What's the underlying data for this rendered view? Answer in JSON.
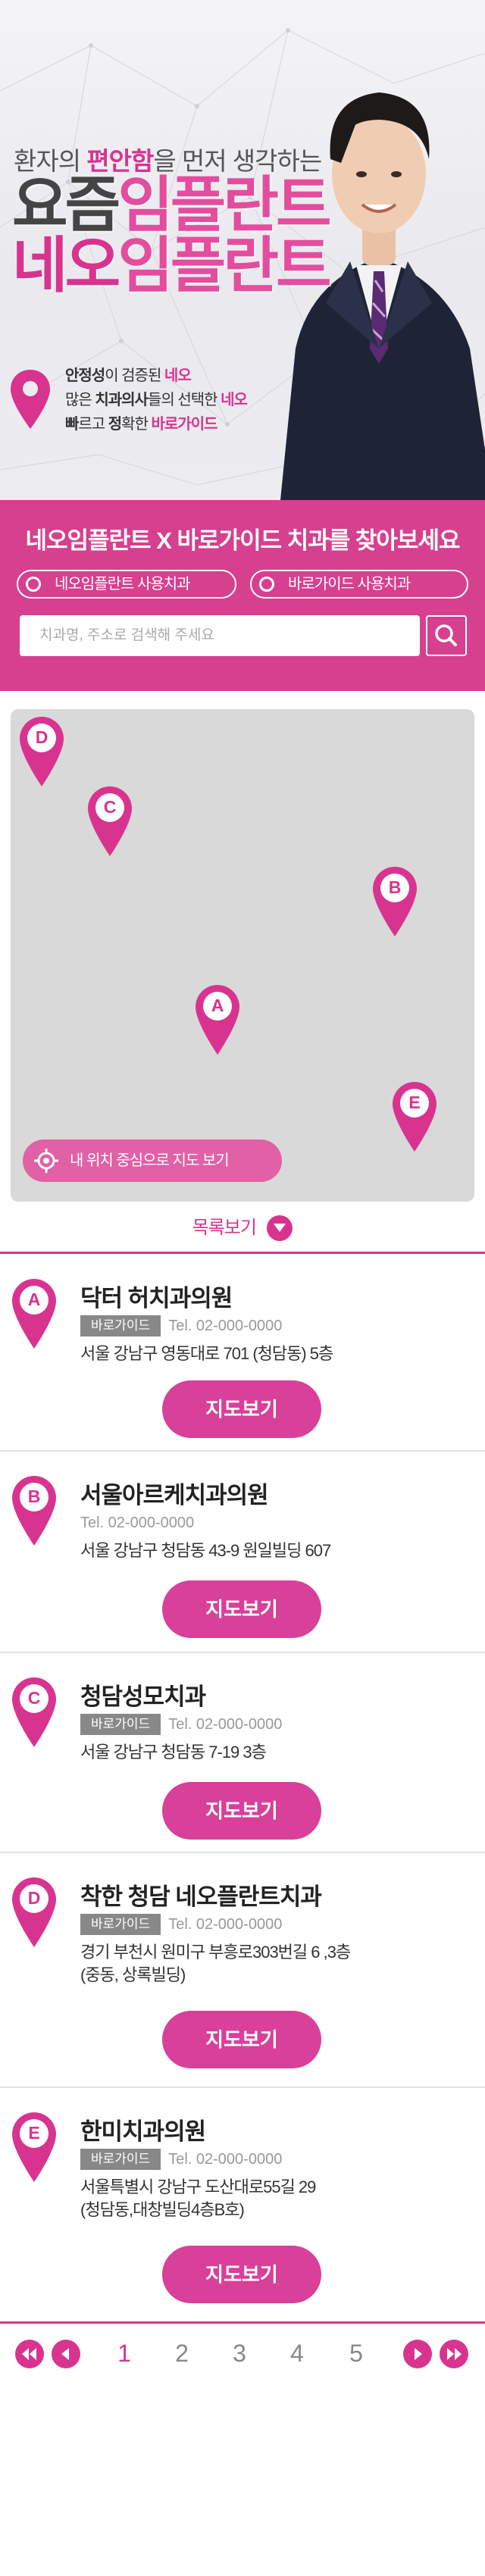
{
  "hero": {
    "tagline_pre": "환자의 ",
    "tagline_em": "편안함",
    "tagline_post": "을 먼저 생각하는",
    "line1_a": "요즘",
    "line1_b": "임플란트",
    "line2_a": "네오",
    "line2_b": "임플란트",
    "points": [
      {
        "b": "안정성",
        "t": "이 검증된 ",
        "p": "네오"
      },
      {
        "b": "",
        "t": "많은 ",
        "b2": "치과의사",
        "t2": "들의 선택한 ",
        "p": "네오"
      },
      {
        "b": "빠",
        "t": "르고 ",
        "b2": "정",
        "t2": "확한 ",
        "p": "바로가이드"
      }
    ]
  },
  "search": {
    "title": "네오임플란트 X 바로가이드 치과를 찾아보세요",
    "radio1": "네오임플란트 사용치과",
    "radio2": "바로가이드 사용치과",
    "placeholder": "치과명, 주소로 검색해 주세요"
  },
  "map": {
    "locate_label": "내 위치 중심으로 지도 보기",
    "pins": [
      "D",
      "C",
      "B",
      "A",
      "E"
    ]
  },
  "list_toggle": "목록보기",
  "clinics": [
    {
      "letter": "A",
      "name": "닥터 허치과의원",
      "badge": "바로가이드",
      "tel": "Tel. 02-000-0000",
      "addr1": "서울 강남구 영동대로 701 (청담동) 5층",
      "addr2": "",
      "button": "지도보기"
    },
    {
      "letter": "B",
      "name": "서울아르케치과의원",
      "badge": "",
      "tel": "Tel. 02-000-0000",
      "addr1": "서울 강남구 청담동 43-9 원일빌딩 607",
      "addr2": "",
      "button": "지도보기"
    },
    {
      "letter": "C",
      "name": "청담성모치과",
      "badge": "바로가이드",
      "tel": "Tel. 02-000-0000",
      "addr1": "서울 강남구 청담동 7-19 3층",
      "addr2": "",
      "button": "지도보기"
    },
    {
      "letter": "D",
      "name": "착한 청담 네오플란트치과",
      "badge": "바로가이드",
      "tel": "Tel. 02-000-0000",
      "addr1": "경기 부천시 원미구 부흥로303번길 6 ,3층",
      "addr2": "(중동, 상록빌딩)",
      "button": "지도보기"
    },
    {
      "letter": "E",
      "name": "한미치과의원",
      "badge": "바로가이드",
      "tel": "Tel. 02-000-0000",
      "addr1": "서울특별시 강남구 도산대로55길 29",
      "addr2": "(청담동,대창빌딩4층B호)",
      "button": "지도보기"
    }
  ],
  "pagination": {
    "pages": [
      "1",
      "2",
      "3",
      "4",
      "5"
    ],
    "current": "1"
  },
  "colors": {
    "brand": "#d8348f",
    "map_bg": "#d9d9d9"
  }
}
